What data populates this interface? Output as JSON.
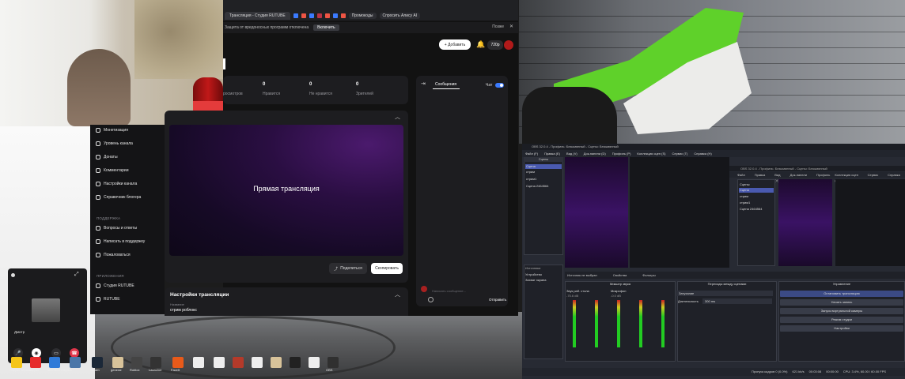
{
  "browser": {
    "tabs": [
      {
        "label": "Трансляция - Студия RUTUBE"
      },
      {
        "label": "Промокоды"
      },
      {
        "label": "Спросить Алису AI"
      }
    ],
    "infobar": {
      "text": "Защита от вредоносных программ отключена",
      "enable_label": "Включить",
      "later_label": "Позже"
    }
  },
  "studio": {
    "header": {
      "add_label": "+ Добавить",
      "quality": "720p"
    },
    "stats": [
      {
        "value": "",
        "label": "росмотров"
      },
      {
        "value": "0",
        "label": "Нравится"
      },
      {
        "value": "0",
        "label": "Не нравится"
      },
      {
        "value": "0",
        "label": "Зрителей"
      }
    ],
    "sidebar": {
      "items_top": [
        "Монетизация",
        "Уровень канала",
        "Донаты",
        "Комментарии",
        "Настройки канала",
        "Справочник блогера"
      ],
      "support_heading": "ПОДДЕРЖКА",
      "support_items": [
        "Вопросы и ответы",
        "Написать в поддержку",
        "Пожаловаться"
      ],
      "apps_heading": "ПРИЛОЖЕНИЯ",
      "apps_items": [
        "Студия RUTUBE",
        "RUTUBE"
      ]
    },
    "player": {
      "label": "Прямая трансляция",
      "share_label": "Поделиться",
      "copy_label": "Скопировать"
    },
    "settings": {
      "title": "Настройки трансляции",
      "name_label": "Название",
      "name_value": "стрим роблокс"
    },
    "chat": {
      "tab_label": "Сообщения",
      "toggle_label": "Чат",
      "input_placeholder": "Написать сообщение...",
      "send_label": "Отправить"
    }
  },
  "call": {
    "name": "Дмитр"
  },
  "taskbar": [
    {
      "label": "Яндекс Музыка",
      "color": "#f5c518"
    },
    {
      "label": "Яндекс",
      "color": "#e62b2b"
    },
    {
      "label": "Microsoft Edge",
      "color": "#2f7ad8"
    },
    {
      "label": "VK",
      "color": "#4a76a8"
    },
    {
      "label": "Steam",
      "color": "#1b2838"
    },
    {
      "label": "general",
      "color": "#d8c39a"
    },
    {
      "label": "Roblox",
      "color": "#444"
    },
    {
      "label": "Launcher",
      "color": "#333"
    },
    {
      "label": "FaceIt",
      "color": "#e85a1a"
    },
    {
      "label": "",
      "color": "#eeeeee"
    },
    {
      "label": "",
      "color": "#eeeeee"
    },
    {
      "label": "",
      "color": "#b43a2a"
    },
    {
      "label": "",
      "color": "#eeeeee"
    },
    {
      "label": "",
      "color": "#d8c39a"
    },
    {
      "label": "",
      "color": "#222222"
    },
    {
      "label": "",
      "color": "#eeeeee"
    },
    {
      "label": "OBS",
      "color": "#303030"
    }
  ],
  "obs": {
    "title": "OBS 32.0.4 - Профиль: Безымянный - Сцены: Безымянный",
    "menu": [
      "Файл (F)",
      "Правка (E)",
      "Вид (V)",
      "Док-панели (D)",
      "Профиль (P)",
      "Коллекция сцен (S)",
      "Сервис (T)",
      "Справка (H)"
    ],
    "scenes_heading": "Сцены",
    "scenes": [
      "Сцена",
      "стрим",
      "стрим1",
      "Сцена 2464564"
    ],
    "sources_heading": "Источники",
    "sources": [
      "Устройство",
      "Захват экрана"
    ],
    "source_bar": {
      "no_source": "Источник не выбран",
      "properties": "Свойства",
      "filters": "Фильтры"
    },
    "mixer_heading": "Микшер звука",
    "mixer_channels": [
      {
        "name": "Global",
        "label": "Звук раб. стола",
        "db": "-75.6 dB"
      },
      {
        "name": "Global",
        "label": "Звук раб. стола 2",
        "db": "-77.4 dB"
      },
      {
        "name": "Global",
        "label": "Микрофон",
        "db": "-0.0 dB"
      },
      {
        "name": "Global",
        "label": "Микрофон 2",
        "db": "-inf dB"
      },
      {
        "name": "Glo",
        "label": "Микро",
        "db": "0.0"
      }
    ],
    "transitions": {
      "heading": "Переходы между сценами",
      "type": "Затухание",
      "duration_label": "Длительность",
      "duration": "300 ms"
    },
    "controls": {
      "heading": "Управление",
      "buttons": [
        "Остановить трансляцию",
        "Начать запись",
        "Запуск виртуальной камеры",
        "Режим студии",
        "Настройки"
      ]
    },
    "status": {
      "dropped": "Пропуск кадров 0 (0.0%)",
      "bitrate": "621 kb/s",
      "time1": "00:03:08",
      "time2": "00:00:00",
      "cpu": "CPU: 3.4%, 60.00 / 60.00 FPS"
    },
    "nested_menu": [
      "Файл (F)",
      "Правка (E)",
      "Вид (V)",
      "Док-панели (D)",
      "Профиль",
      "Коллекция сцен (S)",
      "Сервис (T)",
      "Справка (H)"
    ],
    "nested_scenes": [
      "Сцена",
      "стрим",
      "стрим1",
      "Сцена 2464564"
    ]
  }
}
